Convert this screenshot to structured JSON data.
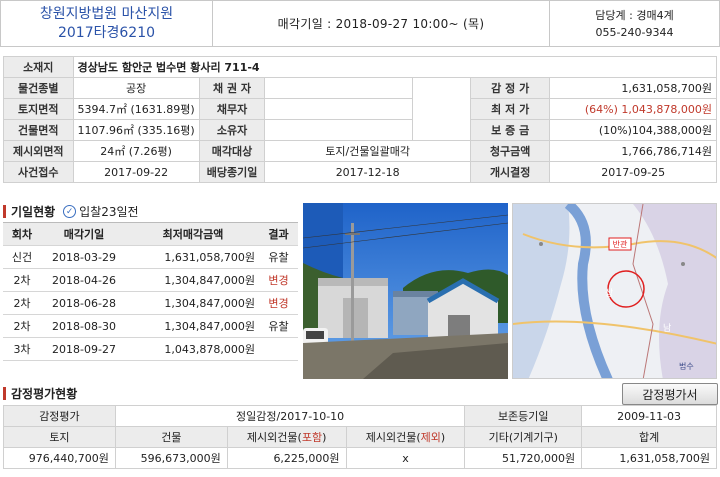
{
  "header": {
    "court": "창원지방법원 마산지원",
    "case_no": "2017타경6210",
    "sale_date": "매각기일 : 2018-09-27 10:00~ (목)",
    "dept": "담당계 : 경매4계",
    "phone": "055-240-9344"
  },
  "info": {
    "address_label": "소재지",
    "address": "경상남도 함안군 법수면 황사리 711-4",
    "type_label": "물건종별",
    "type": "공장",
    "creditor_label": "채 권 자",
    "creditor": "",
    "appraisal_label": "감 정 가",
    "appraisal": "1,631,058,700원",
    "land_label": "토지면적",
    "land": "5394.7㎡ (1631.89평)",
    "debtor_label": "채무자",
    "debtor": "",
    "min_label": "최 저 가",
    "min_rate": "(64%)",
    "min_price": "1,043,878,000원",
    "bldg_label": "건물면적",
    "bldg": "1107.96㎡ (335.16평)",
    "owner_label": "소유자",
    "owner": "",
    "deposit_label": "보 증 금",
    "deposit": "(10%)104,388,000원",
    "excl_label": "제시외면적",
    "excl": "24㎡ (7.26평)",
    "target_label": "매각대상",
    "target": "토지/건물일괄매각",
    "claim_label": "청구금액",
    "claim": "1,766,786,714원",
    "received_label": "사건접수",
    "received": "2017-09-22",
    "dividend_label": "배당종기일",
    "dividend": "2017-12-18",
    "start_label": "개시결정",
    "start": "2017-09-25"
  },
  "history": {
    "title": "기일현황",
    "note": "입찰23일전",
    "columns": [
      "회차",
      "매각기일",
      "최저매각금액",
      "결과"
    ],
    "rows": [
      {
        "round": "신건",
        "date": "2018-03-29",
        "amount": "1,631,058,700원",
        "result": "유찰",
        "red": false
      },
      {
        "round": "2차",
        "date": "2018-04-26",
        "amount": "1,304,847,000원",
        "result": "변경",
        "red": true
      },
      {
        "round": "2차",
        "date": "2018-06-28",
        "amount": "1,304,847,000원",
        "result": "변경",
        "red": true
      },
      {
        "round": "2차",
        "date": "2018-08-30",
        "amount": "1,304,847,000원",
        "result": "유찰",
        "red": false
      },
      {
        "round": "3차",
        "date": "2018-09-27",
        "amount": "1,043,878,000원",
        "result": "",
        "red": false
      }
    ]
  },
  "map": {
    "tag": "반관",
    "labels": [
      "상",
      "남",
      "법수"
    ]
  },
  "appraisal": {
    "title": "감정평가현황",
    "button": "감정평가서",
    "row1": {
      "label": "감정평가",
      "value": "정일감정/2017-10-10",
      "pres_label": "보존등기일",
      "pres_value": "2009-11-03"
    },
    "headers": {
      "land": "토지",
      "bldg": "건물",
      "excl_in_pre": "제시외건물(",
      "excl_in_red": "포함",
      "excl_out_pre": "제시외건물(",
      "excl_out_red": "제외",
      "etc": "기타(기계기구)",
      "total": "합계"
    },
    "values": {
      "land": "976,440,700원",
      "bldg": "596,673,000원",
      "excl_in": "6,225,000원",
      "excl_out": "x",
      "etc": "51,720,000원",
      "total": "1,631,058,700원"
    }
  }
}
